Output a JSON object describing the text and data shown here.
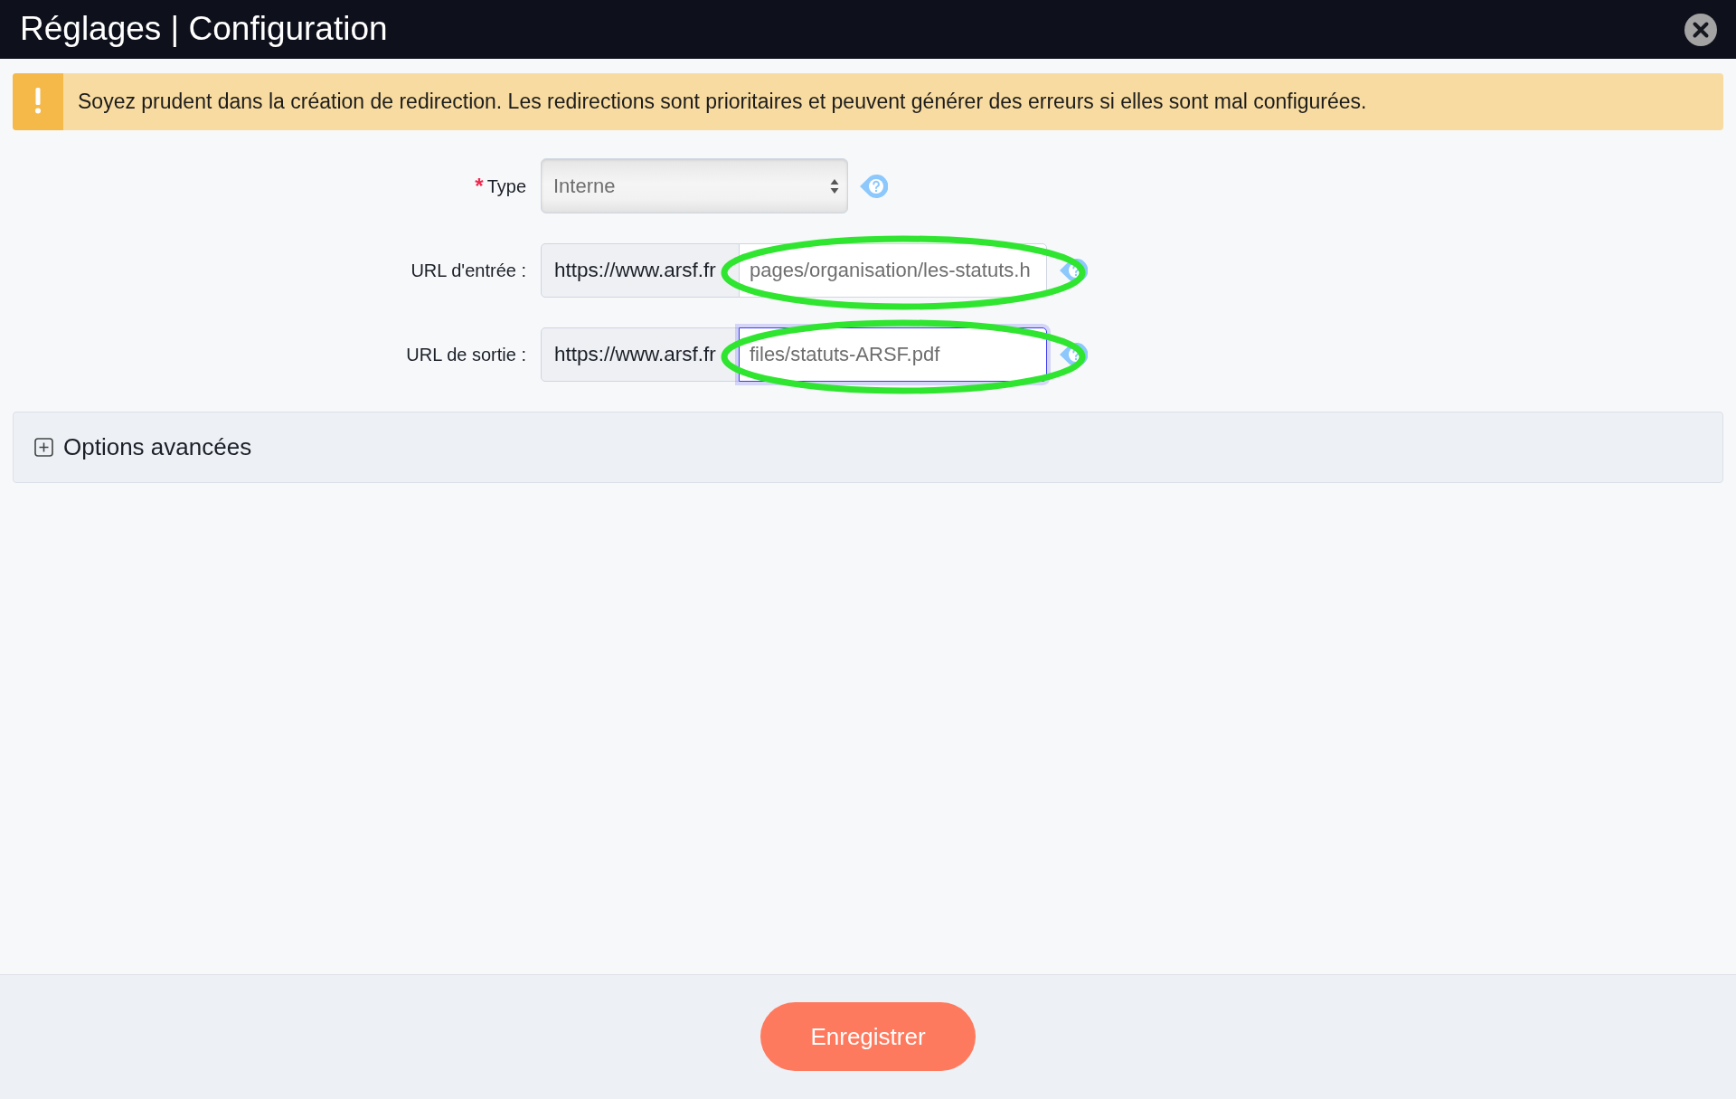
{
  "window": {
    "title": "Réglages | Configuration"
  },
  "alert": {
    "kind": "warning",
    "text": "Soyez prudent dans la création de redirection. Les redirections sont prioritaires et peuvent générer des erreurs si elles sont mal configurées."
  },
  "form": {
    "fields": [
      {
        "kind": "select",
        "label": "Type",
        "required_mark": "*",
        "value": "Interne",
        "focused": false
      },
      {
        "kind": "url",
        "label": "URL d'entrée :",
        "prefix": "https://www.arsf.fr",
        "value": "pages/organisation/les-statuts.h",
        "focused": false,
        "highlighted": true
      },
      {
        "kind": "url",
        "label": "URL de sortie :",
        "prefix": "https://www.arsf.fr",
        "value": "files/statuts-ARSF.pdf",
        "focused": true,
        "highlighted": true
      }
    ]
  },
  "advanced_options": {
    "label": "Options avancées",
    "expanded": false
  },
  "footer": {
    "save_button": "Enregistrer"
  }
}
